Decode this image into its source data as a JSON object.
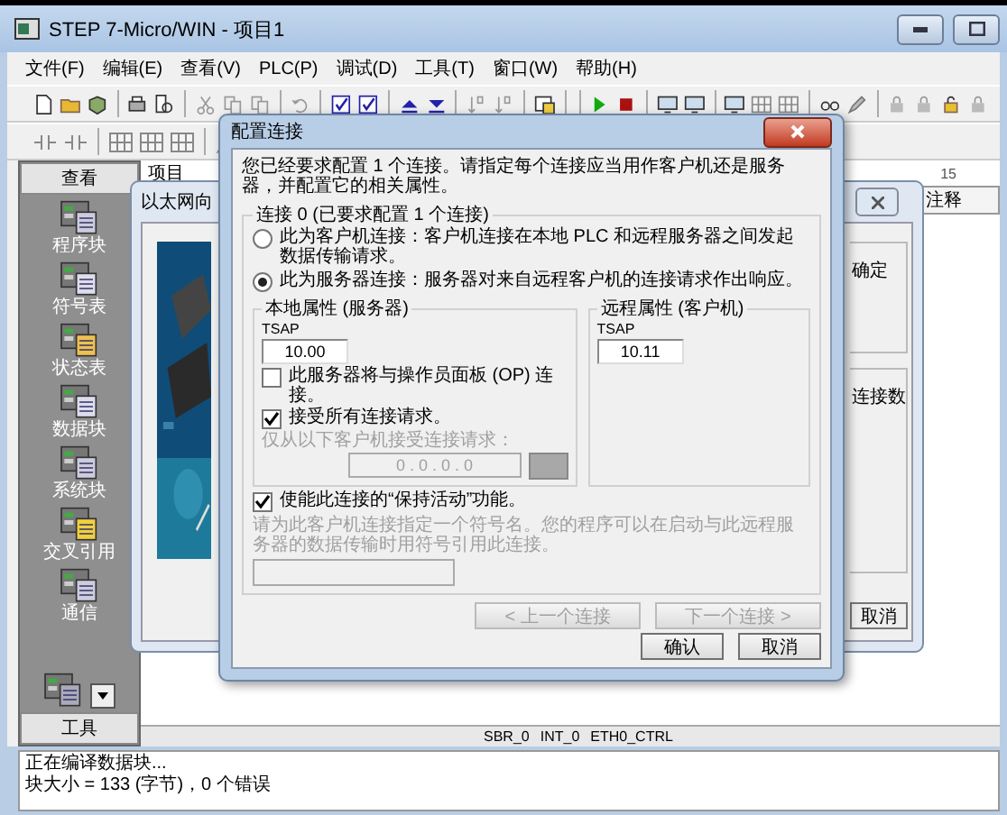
{
  "window": {
    "title": "STEP 7-Micro/WIN - 项目1"
  },
  "menu": [
    "文件(F)",
    "编辑(E)",
    "查看(V)",
    "PLC(P)",
    "调试(D)",
    "工具(T)",
    "窗口(W)",
    "帮助(H)"
  ],
  "navbar": {
    "header": "查看",
    "items": [
      {
        "label": "程序块"
      },
      {
        "label": "符号表"
      },
      {
        "label": "状态表"
      },
      {
        "label": "数据块"
      },
      {
        "label": "系统块"
      },
      {
        "label": "交叉引用"
      },
      {
        "label": "通信"
      }
    ],
    "footer": "工具"
  },
  "tree": {
    "root": "项目"
  },
  "ruler": "15",
  "columns": [
    "注释"
  ],
  "editor_tabs": [
    "SBR_0",
    "INT_0",
    "ETH0_CTRL"
  ],
  "status": [
    "正在编译数据块...",
    "块大小 = 133 (字节)，0 个错误"
  ],
  "wizard": {
    "title": "以太网向",
    "labels": [
      "确定",
      "连接数"
    ],
    "cancel": "取消"
  },
  "dialog": {
    "title": "配置连接",
    "intro": "您已经要求配置 1 个连接。请指定每个连接应当用作客户机还是服务器，并配置它的相关属性。",
    "group_title": "连接 0 (已要求配置 1 个连接)",
    "roles": [
      {
        "label": "此为客户机连接：客户机连接在本地 PLC 和远程服务器之间发起数据传输请求。",
        "selected": false
      },
      {
        "label": "此为服务器连接：服务器对来自远程客户机的连接请求作出响应。",
        "selected": true
      }
    ],
    "local": {
      "title": "本地属性 (服务器)",
      "tsap_label": "TSAP",
      "tsap": "10.00",
      "checks": [
        {
          "label": "此服务器将与操作员面板 (OP) 连接。",
          "checked": false
        },
        {
          "label": "接受所有连接请求。",
          "checked": true
        }
      ],
      "only_from": {
        "label": "仅从以下客户机接受连接请求：",
        "disabled": true,
        "address": "0 . 0 . 0 . 0"
      }
    },
    "remote": {
      "title": "远程属性 (客户机)",
      "tsap_label": "TSAP",
      "tsap": "10.11"
    },
    "keep_alive": {
      "label": "使能此连接的“保持活动”功能。",
      "checked": true
    },
    "symbol": {
      "hint": "请为此客户机连接指定一个符号名。您的程序可以在启动与此远程服务器的数据传输时用符号引用此连接。",
      "disabled": true
    },
    "nav_buttons": [
      {
        "label": "< 上一个连接",
        "disabled": true
      },
      {
        "label": "下一个连接 >",
        "disabled": true
      }
    ],
    "ok": "确认",
    "cancel": "取消"
  }
}
